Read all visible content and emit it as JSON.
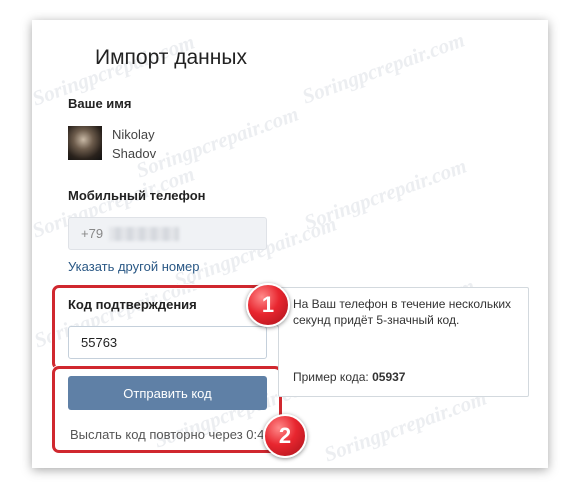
{
  "form": {
    "title": "Импорт данных",
    "name_label": "Ваше имя",
    "user_first_name": "Nikolay",
    "user_last_name": "Shadov",
    "phone_label": "Мобильный телефон",
    "phone_prefix": "+79",
    "change_number_link": "Указать другой номер",
    "code_label": "Код подтверждения",
    "code_value": "55763",
    "send_button_label": "Отправить код",
    "resend_text": "Выслать код повторно через 0:43"
  },
  "tooltip": {
    "text": "На Ваш телефон в течение нескольких секунд придёт 5-значный код.",
    "example_label": "Пример кода:",
    "example_code": "05937"
  },
  "annotations": {
    "badge_1": "1",
    "badge_2": "2"
  },
  "watermark": "Soringpcrepair.com",
  "colors": {
    "accent_button": "#5f80a6",
    "link": "#2a5885",
    "highlight": "#d0282f"
  }
}
